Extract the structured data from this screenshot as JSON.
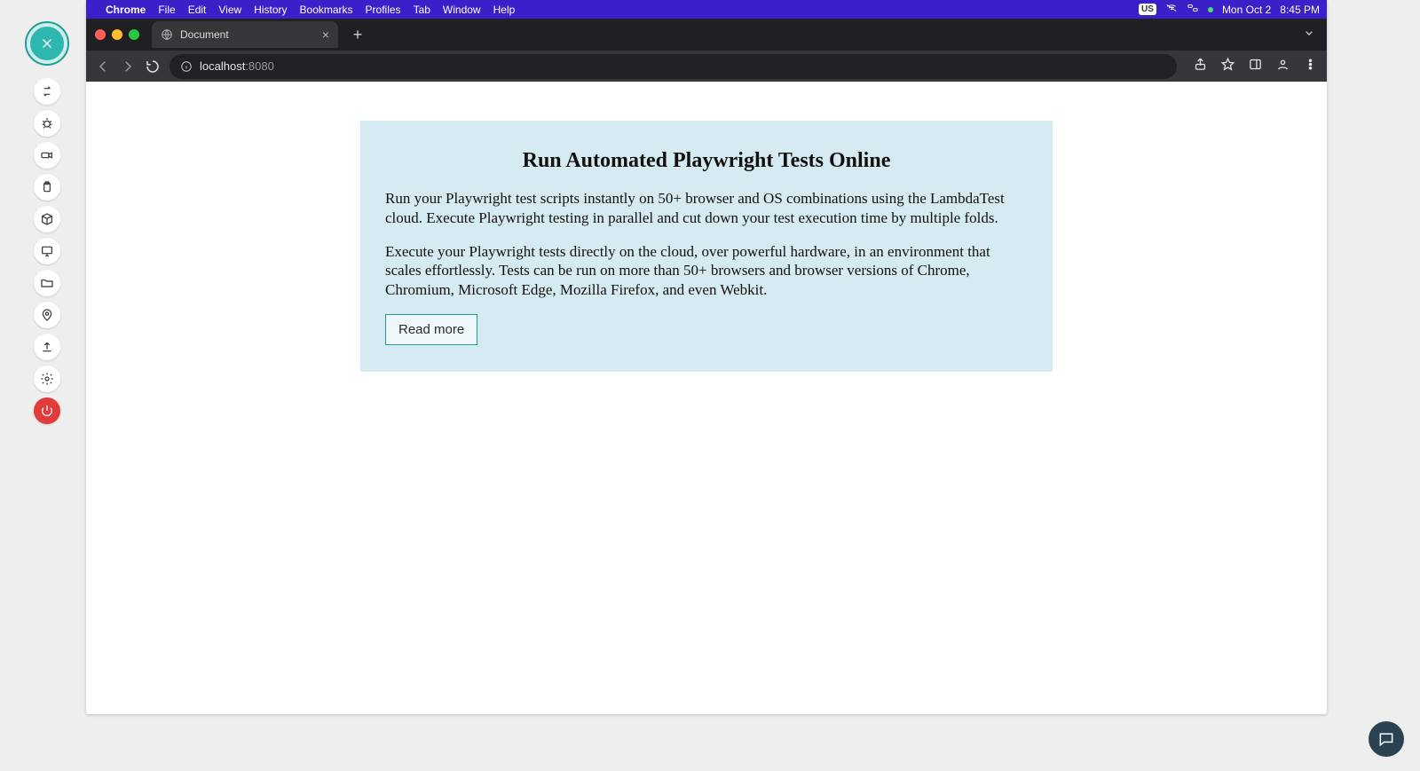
{
  "rail": {
    "icons": [
      "close",
      "swap",
      "bug",
      "video",
      "clipboard",
      "cube",
      "monitor",
      "folder",
      "pin",
      "upload",
      "gear",
      "power"
    ]
  },
  "menubar": {
    "apple": "",
    "items": [
      "Chrome",
      "File",
      "Edit",
      "View",
      "History",
      "Bookmarks",
      "Profiles",
      "Tab",
      "Window",
      "Help"
    ],
    "right": {
      "locale_badge": "US",
      "date": "Mon Oct 2",
      "time": "8:45 PM"
    }
  },
  "tabs": {
    "active": {
      "title": "Document"
    },
    "newtab": "+"
  },
  "toolbar": {
    "address": {
      "host": "localhost",
      "port": ":8080"
    }
  },
  "page": {
    "heading": "Run Automated Playwright Tests Online",
    "para1": "Run your Playwright test scripts instantly on 50+ browser and OS combinations using the LambdaTest cloud. Execute Playwright testing in parallel and cut down your test execution time by multiple folds.",
    "para2": "Execute your Playwright tests directly on the cloud, over powerful hardware, in an environment that scales effortlessly. Tests can be run on more than 50+ browsers and browser versions of Chrome, Chromium, Microsoft Edge, Mozilla Firefox, and even Webkit.",
    "read_more": "Read more"
  }
}
